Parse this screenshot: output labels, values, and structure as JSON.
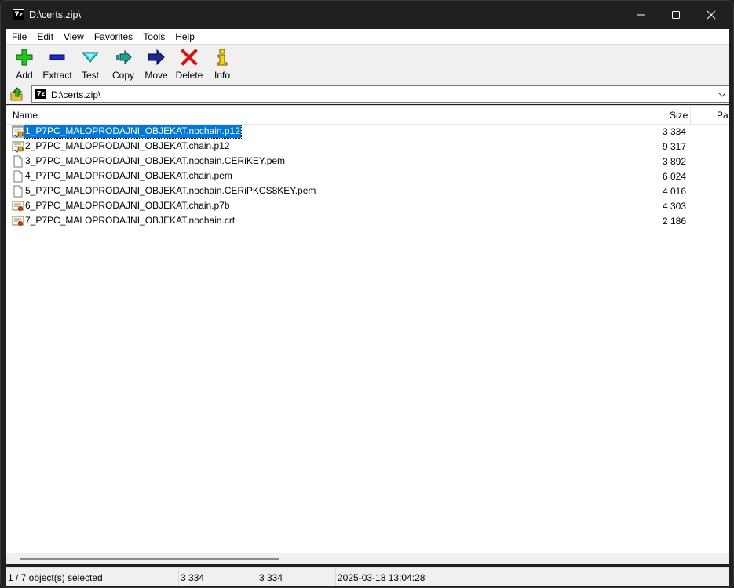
{
  "window": {
    "app_icon_text": "7z",
    "title": "D:\\certs.zip\\"
  },
  "menu": [
    "File",
    "Edit",
    "View",
    "Favorites",
    "Tools",
    "Help"
  ],
  "toolbar": [
    {
      "label": "Add",
      "icon": "add-icon"
    },
    {
      "label": "Extract",
      "icon": "extract-icon"
    },
    {
      "label": "Test",
      "icon": "test-icon"
    },
    {
      "label": "Copy",
      "icon": "copy-icon"
    },
    {
      "label": "Move",
      "icon": "move-icon"
    },
    {
      "label": "Delete",
      "icon": "delete-icon"
    },
    {
      "label": "Info",
      "icon": "info-icon"
    }
  ],
  "address": {
    "path": "D:\\certs.zip\\"
  },
  "columns": {
    "name": "Name",
    "size": "Size",
    "packed": "Pac"
  },
  "files": [
    {
      "name": "1_P7PC_MALOPRODAJNI_OBJEKAT.nochain.p12",
      "size": "3 334",
      "icon": "pfx-certificate-icon",
      "selected": true
    },
    {
      "name": "2_P7PC_MALOPRODAJNI_OBJEKAT.chain.p12",
      "size": "9 317",
      "icon": "pfx-certificate-icon",
      "selected": false
    },
    {
      "name": "3_P7PC_MALOPRODAJNI_OBJEKAT.nochain.CERiKEY.pem",
      "size": "3 892",
      "icon": "file-icon",
      "selected": false
    },
    {
      "name": "4_P7PC_MALOPRODAJNI_OBJEKAT.chain.pem",
      "size": "6 024",
      "icon": "file-icon",
      "selected": false
    },
    {
      "name": "5_P7PC_MALOPRODAJNI_OBJEKAT.nochain.CERiPKCS8KEY.pem",
      "size": "4 016",
      "icon": "file-icon",
      "selected": false
    },
    {
      "name": "6_P7PC_MALOPRODAJNI_OBJEKAT.chain.p7b",
      "size": "4 303",
      "icon": "certificate-icon",
      "selected": false
    },
    {
      "name": "7_P7PC_MALOPRODAJNI_OBJEKAT.nochain.crt",
      "size": "2 186",
      "icon": "certificate-icon",
      "selected": false
    }
  ],
  "status": {
    "selection": "1 / 7 object(s) selected",
    "size": "3 334",
    "packed": "3 334",
    "modified": "2025-03-18 13:04:28"
  },
  "colors": {
    "selection": "#0078d7",
    "titlebar": "#202020"
  }
}
